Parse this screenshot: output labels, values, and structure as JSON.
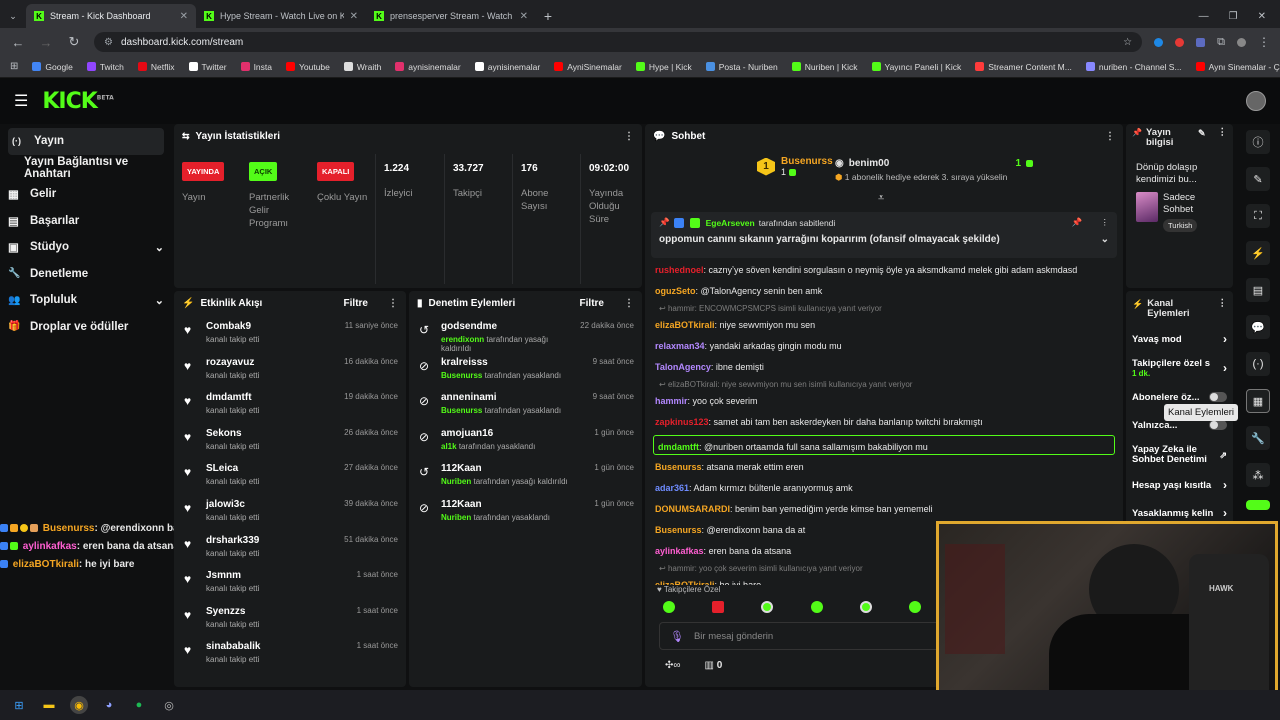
{
  "browser": {
    "tabs": [
      {
        "title": "Stream - Kick Dashboard",
        "active": true
      },
      {
        "title": "Hype Stream - Watch Live on K",
        "active": false
      },
      {
        "title": "prensesperver Stream - Watch",
        "active": false
      }
    ],
    "new_tab_symbol": "+",
    "url": "dashboard.kick.com/stream",
    "bookmarks": [
      {
        "label": "Google",
        "color": "#4285f4"
      },
      {
        "label": "Twitch",
        "color": "#9146ff"
      },
      {
        "label": "Netflix",
        "color": "#e50914"
      },
      {
        "label": "Twitter",
        "color": "#ffffff"
      },
      {
        "label": "Insta",
        "color": "#e1306c"
      },
      {
        "label": "Youtube",
        "color": "#ff0000"
      },
      {
        "label": "Wraith",
        "color": "#dddddd"
      },
      {
        "label": "aynisinemalar",
        "color": "#e1306c"
      },
      {
        "label": "aynisinemalar",
        "color": "#ffffff"
      },
      {
        "label": "AyniSinemalar",
        "color": "#ff0000"
      },
      {
        "label": "Hype | Kick",
        "color": "#53fc18"
      },
      {
        "label": "Posta - Nuriben",
        "color": "#4a90e2"
      },
      {
        "label": "Nuriben | Kick",
        "color": "#53fc18"
      },
      {
        "label": "Yayıncı Paneli | Kick",
        "color": "#53fc18"
      },
      {
        "label": "Streamer Content M...",
        "color": "#ff3b3b"
      },
      {
        "label": "nuriben - Channel S...",
        "color": "#8888ff"
      },
      {
        "label": "Aynı Sinemalar - Ça...",
        "color": "#ff0000"
      }
    ]
  },
  "header": {
    "logo": "KICK",
    "beta": "BETA"
  },
  "sidebar": {
    "items": [
      {
        "label": "Yayın",
        "icon": "broadcast-icon",
        "glyph": "(·)"
      },
      {
        "label": "Yayın Bağlantısı ve Anahtarı",
        "icon": "",
        "glyph": ""
      },
      {
        "label": "Gelir",
        "icon": "revenue-icon",
        "glyph": "▦"
      },
      {
        "label": "Başarılar",
        "icon": "achievements-icon",
        "glyph": "▤"
      },
      {
        "label": "Stüdyo",
        "icon": "studio-icon",
        "glyph": "▣"
      },
      {
        "label": "Denetleme",
        "icon": "wrench-icon",
        "glyph": "🔧"
      },
      {
        "label": "Topluluk",
        "icon": "community-icon",
        "glyph": "👥"
      },
      {
        "label": "Droplar ve ödüller",
        "icon": "gift-icon",
        "glyph": "🎁"
      }
    ]
  },
  "stats": {
    "title": "Yayın İstatistikleri",
    "items": [
      {
        "badge": "YAYINDA",
        "badge_color": "#e5202b",
        "badge_text": "#ffffff",
        "label": "Yayın"
      },
      {
        "badge": "AÇIK",
        "badge_color": "#53fc18",
        "badge_text": "#0b3d00",
        "label": "Partnerlik Gelir Programı"
      },
      {
        "badge": "KAPALI",
        "badge_color": "#e5202b",
        "badge_text": "#ffffff",
        "label": "Çoklu Yayın"
      },
      {
        "value": "1.224",
        "label": "İzleyici"
      },
      {
        "value": "33.727",
        "label": "Takipçi"
      },
      {
        "value": "176",
        "label": "Abone Sayısı"
      },
      {
        "value": "09:02:00",
        "label": "Yayında Olduğu Süre"
      }
    ]
  },
  "activity": {
    "title": "Etkinlik Akışı",
    "filter": "Filtre",
    "rows": [
      {
        "name": "Combak9",
        "sub": "kanalı takip etti",
        "time": "11 saniye önce"
      },
      {
        "name": "rozayavuz",
        "sub": "kanalı takip etti",
        "time": "16 dakika önce"
      },
      {
        "name": "dmdamtft",
        "sub": "kanalı takip etti",
        "time": "19 dakika önce"
      },
      {
        "name": "Sekons",
        "sub": "kanalı takip etti",
        "time": "26 dakika önce"
      },
      {
        "name": "SLeica",
        "sub": "kanalı takip etti",
        "time": "27 dakika önce"
      },
      {
        "name": "jalowi3c",
        "sub": "kanalı takip etti",
        "time": "39 dakika önce"
      },
      {
        "name": "drshark339",
        "sub": "kanalı takip etti",
        "time": "51 dakika önce"
      },
      {
        "name": "Jsmnm",
        "sub": "kanalı takip etti",
        "time": "1 saat önce"
      },
      {
        "name": "Syenzzs",
        "sub": "kanalı takip etti",
        "time": "1 saat önce"
      },
      {
        "name": "sinababalik",
        "sub": "kanalı takip etti",
        "time": "1 saat önce"
      }
    ]
  },
  "moderation": {
    "title": "Denetim Eylemleri",
    "filter": "Filtre",
    "rows": [
      {
        "icon": "unban-icon",
        "glyph": "↺",
        "name": "godsendme",
        "actor": "erendixonn",
        "sub": "tarafından yasağı kaldırıldı",
        "time": "22 dakika önce"
      },
      {
        "icon": "ban-icon",
        "glyph": "⊘",
        "name": "kralreisss",
        "actor": "Busenurss",
        "sub": "tarafından yasaklandı",
        "time": "9 saat önce"
      },
      {
        "icon": "ban-icon",
        "glyph": "⊘",
        "name": "anneninami",
        "actor": "Busenurss",
        "sub": "tarafından yasaklandı",
        "time": "9 saat önce"
      },
      {
        "icon": "ban-icon",
        "glyph": "⊘",
        "name": "amojuan16",
        "actor": "al1k",
        "sub": "tarafından yasaklandı",
        "time": "1 gün önce"
      },
      {
        "icon": "unban-icon",
        "glyph": "↺",
        "name": "112Kaan",
        "actor": "Nuriben",
        "sub": "tarafından yasağı kaldırıldı",
        "time": "1 gün önce"
      },
      {
        "icon": "ban-icon",
        "glyph": "⊘",
        "name": "112Kaan",
        "actor": "Nuriben",
        "sub": "tarafından yasaklandı",
        "time": "1 gün önce"
      }
    ]
  },
  "chat": {
    "title": "Sohbet",
    "top": {
      "user1": "Busenurss",
      "count1": "1",
      "user2": "benim00",
      "count2": "1",
      "gift_text": "1 abonelik hediye ederek 3. sıraya yükselin"
    },
    "pinned": {
      "user": "EgeArseven",
      "by": "tarafından sabitlendi",
      "text": "oppomun canını sıkanın yarrağını koparırım (ofansif olmayacak şekilde)"
    },
    "messages": [
      {
        "type": "msg",
        "user": "rushednoel",
        "color": "#e5202b",
        "text": "caznyʼye söven kendini sorgulasın o neymiş öyle ya aksmdkamd melek gibi adam askmdasd"
      },
      {
        "type": "msg",
        "user": "oguzSeto",
        "color": "#f5a623",
        "text": "@TalonAgency senin ben amk"
      },
      {
        "type": "reply",
        "text": "hammir: ENCOWMCPSMCPS isimli kullanıcıya yanıt veriyor"
      },
      {
        "type": "msg",
        "user": "elizaBOTkirali",
        "color": "#f5a623",
        "text": "niye sewvmiyon mu sen"
      },
      {
        "type": "msg",
        "user": "relaxman34",
        "color": "#b388ff",
        "text": "yandaki arkadaş gingin modu mu"
      },
      {
        "type": "msg",
        "user": "TalonAgency",
        "color": "#b388ff",
        "text": "ibne demişti"
      },
      {
        "type": "reply",
        "text": "elizaBOTkirali: niye sewvmiyon mu sen isimli kullanıcıya yanıt veriyor"
      },
      {
        "type": "msg",
        "user": "hammir",
        "color": "#b388ff",
        "text": "yoo çok severim"
      },
      {
        "type": "msg",
        "user": "zapkinus123",
        "color": "#e5202b",
        "text": "samet abi tam ben askerdeyken bir daha banlanıp twitchi bırakmıştı"
      },
      {
        "type": "highlight",
        "user": "dmdamtft",
        "color": "#53fc18",
        "text": "@nuriben ortaamda full sana sallamışım bakabiliyon mu"
      },
      {
        "type": "msg",
        "user": "Busenurss",
        "color": "#f5a623",
        "text": "atsana merak ettim eren"
      },
      {
        "type": "msg",
        "user": "adar361",
        "color": "#6f8cff",
        "text": "Adam kırmızı bültenle aranıyormuş amk"
      },
      {
        "type": "msg",
        "user": "DONUMSARARDI",
        "color": "#f5a623",
        "text": "benim ban yemediğim yerde kimse ban yememeli"
      },
      {
        "type": "msg",
        "user": "Busenurss",
        "color": "#f5a623",
        "text": "@erendixonn bana da at"
      },
      {
        "type": "msg",
        "user": "aylinkafkas",
        "color": "#ff5fd2",
        "text": "eren bana da atsana"
      },
      {
        "type": "reply",
        "text": "hammir: yoo çok severim isimli kullanıcıya yanıt veriyor"
      },
      {
        "type": "msg",
        "user": "elizaBOTkirali",
        "color": "#f5a623",
        "text": "he iyi bare"
      }
    ],
    "followers_only": "Takipçilere Özel",
    "input_placeholder": "Bir mesaj gönderin",
    "points": "0"
  },
  "stream_info": {
    "title": "Yayın bilgisi",
    "stream_title": "Dönüp dolaşıp kendimizi bu...",
    "category": "Sadece Sohbet",
    "language": "Turkish"
  },
  "channel_actions": {
    "title": "Kanal Eylemleri",
    "items": [
      {
        "label": "Yavaş mod",
        "kind": "arrow"
      },
      {
        "label": "Takipçilere özel s",
        "sub": "1 dk.",
        "kind": "arrow"
      },
      {
        "label": "Abonelere öz...",
        "kind": "toggle"
      },
      {
        "label": "Yalnızca...",
        "kind": "toggle"
      },
      {
        "label": "Yapay Zeka ile Sohbet Denetimi",
        "kind": "external"
      },
      {
        "label": "Hesap yaşı kısıtla",
        "kind": "arrow"
      },
      {
        "label": "Yasaklanmış kelin",
        "kind": "arrow"
      }
    ],
    "tooltip": "Kanal Eylemleri"
  },
  "overlay_chat": [
    {
      "user": "Busenurss",
      "color": "#f5a623",
      "text": ": @erendixonn bana da at"
    },
    {
      "user": "aylinkafkas",
      "color": "#ff5fd2",
      "text": ": eren bana da atsana"
    },
    {
      "user": "elizaBOTkirali",
      "color": "#f5a623",
      "text": ": he iyi bare"
    }
  ],
  "webcam": {
    "hat_text": "HAWK"
  },
  "colors": {
    "accent": "#53fc18",
    "panel": "#191b1c",
    "background": "#0f1011",
    "webcam_border": "#e0a82e"
  }
}
